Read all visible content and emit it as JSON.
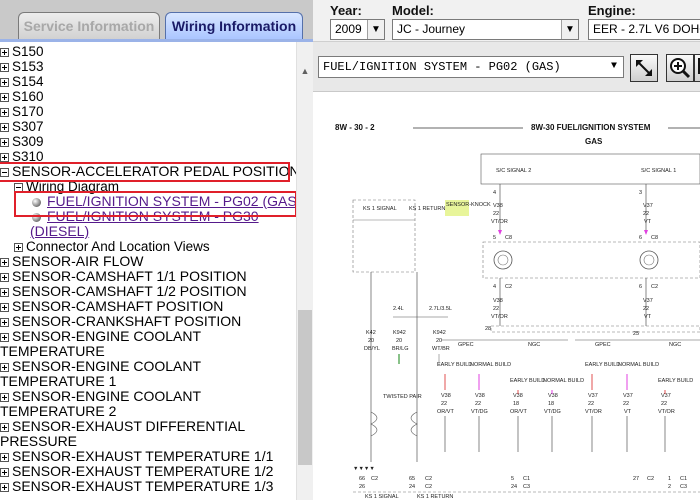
{
  "tabs": {
    "service": "Service Information",
    "wiring": "Wiring Information"
  },
  "vehicle": {
    "year_label": "Year:",
    "year_value": "2009",
    "model_label": "Model:",
    "model_value": "JC - Journey",
    "engine_label": "Engine:",
    "engine_value": "EER - 2.7L V6 DOHC"
  },
  "tree": {
    "nodes": [
      "S150",
      "S153",
      "S154",
      "S160",
      "S170",
      "S307",
      "S309",
      "S310",
      "SENSOR-ACCELERATOR PEDAL POSITION",
      "Wiring Diagram",
      "FUEL/IGNITION SYSTEM - PG02 (GAS)",
      "FUEL/IGNITION SYSTEM - PG30",
      "(DIESEL)",
      "Connector And Location Views",
      "SENSOR-AIR FLOW",
      "SENSOR-CAMSHAFT 1/1 POSITION",
      "SENSOR-CAMSHAFT 1/2 POSITION",
      "SENSOR-CAMSHAFT POSITION",
      "SENSOR-CRANKSHAFT POSITION",
      "SENSOR-ENGINE COOLANT",
      "TEMPERATURE",
      "SENSOR-ENGINE COOLANT",
      "TEMPERATURE 1",
      "SENSOR-ENGINE COOLANT",
      "TEMPERATURE 2",
      "SENSOR-EXHAUST DIFFERENTIAL",
      "PRESSURE",
      "SENSOR-EXHAUST TEMPERATURE 1/1",
      "SENSOR-EXHAUST TEMPERATURE 1/2",
      "SENSOR-EXHAUST TEMPERATURE 1/3"
    ]
  },
  "diagram": {
    "selected": "FUEL/IGNITION SYSTEM - PG02 (GAS)",
    "page_ref": "8W - 30 - 2",
    "title": "8W-30 FUEL/IGNITION SYSTEM",
    "subtitle": "GAS",
    "labels": {
      "sc_signal2": "S/C SIGNAL 2",
      "sc_signal1": "S/C SIGNAL 1",
      "ks1_signal": "KS 1 SIGNAL",
      "ks1_return": "KS 1 RETURN",
      "sensor_knock": "SENSOR-KNOCK",
      "twisted_pair": "TWISTED PAIR",
      "gpec": "GPEC",
      "ngc": "NGC",
      "early_build": "EARLY BUILD",
      "normal_build": "NORMAL BUILD",
      "v38": "V38",
      "v37": "V37",
      "k42": "K42",
      "k942": "K942",
      "c8": "C8",
      "c2": "C2",
      "c1": "C1",
      "c3": "C3",
      "wire_22": "22",
      "wire_20": "20",
      "wire_18": "18",
      "vt_or": "VT/OR",
      "or_vt": "OR/VT",
      "vt": "VT",
      "vt_dg": "VT/DG",
      "db_yl": "DB/YL",
      "br_lg": "BR/LG",
      "wt_br": "WT/BR",
      "v_24l": "2.4L",
      "v_27l": "2.7L/3.5L",
      "pin_4": "4",
      "pin_3": "3",
      "pin_5": "5",
      "pin_6": "6",
      "pin_25": "25",
      "pin_28": "28",
      "pin_65": "65",
      "pin_66": "66",
      "pin_24": "24",
      "pin_27": "27",
      "pin_26": "26",
      "pin_1": "1",
      "pin_2": "2"
    }
  },
  "colors": {
    "highlight": "#e0202a",
    "link": "#551a8b",
    "wiring_tab": "#a9c4ff"
  },
  "icons": {
    "fit": "fit-window-icon",
    "zoom": "zoom-in-icon",
    "fullscreen": "fullscreen-icon"
  }
}
